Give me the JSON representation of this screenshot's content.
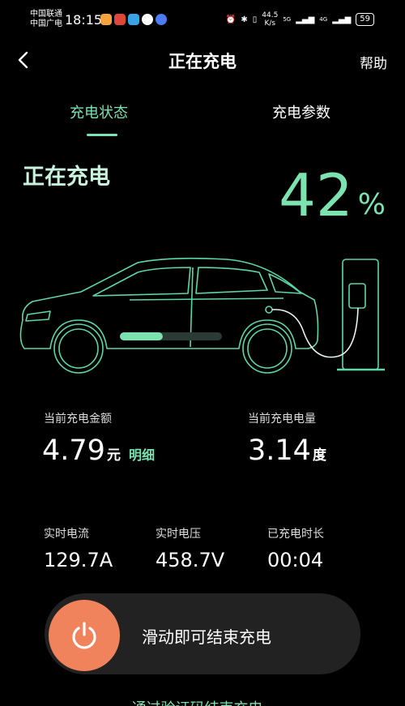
{
  "status_bar": {
    "carrier_1": "中国联通",
    "carrier_2": "中国广电",
    "time": "18:15",
    "speed_value": "44.5",
    "speed_unit": "K/s",
    "network_1": "5G",
    "network_2": "4G",
    "battery": "59",
    "app_icon_colors": [
      "#f7a33b",
      "#e0463a",
      "#3aa3e8",
      "#ffffff",
      "#4d7cf0"
    ]
  },
  "header": {
    "title": "正在充电",
    "help": "帮助"
  },
  "tabs": [
    {
      "label": "充电状态",
      "active": true
    },
    {
      "label": "充电参数",
      "active": false
    }
  ],
  "status": {
    "label": "正在充电",
    "percent_value": "42",
    "percent_sign": "%",
    "progress_fraction": 0.42
  },
  "stats": {
    "amount": {
      "label": "当前充电金额",
      "value": "4.79",
      "unit": "元",
      "link": "明细"
    },
    "energy": {
      "label": "当前充电电量",
      "value": "3.14",
      "unit": "度"
    }
  },
  "realtime": [
    {
      "label": "实时电流",
      "value": "129.7A"
    },
    {
      "label": "实时电压",
      "value": "458.7V"
    },
    {
      "label": "已充电时长",
      "value": "00:04"
    }
  ],
  "slider": {
    "text": "滑动即可结束充电"
  },
  "footer": {
    "hint": "通过验证码结束充电 ›"
  },
  "colors": {
    "accent": "#7be2b0",
    "knob": "#f0835c",
    "outline": "#5fd6a6"
  }
}
